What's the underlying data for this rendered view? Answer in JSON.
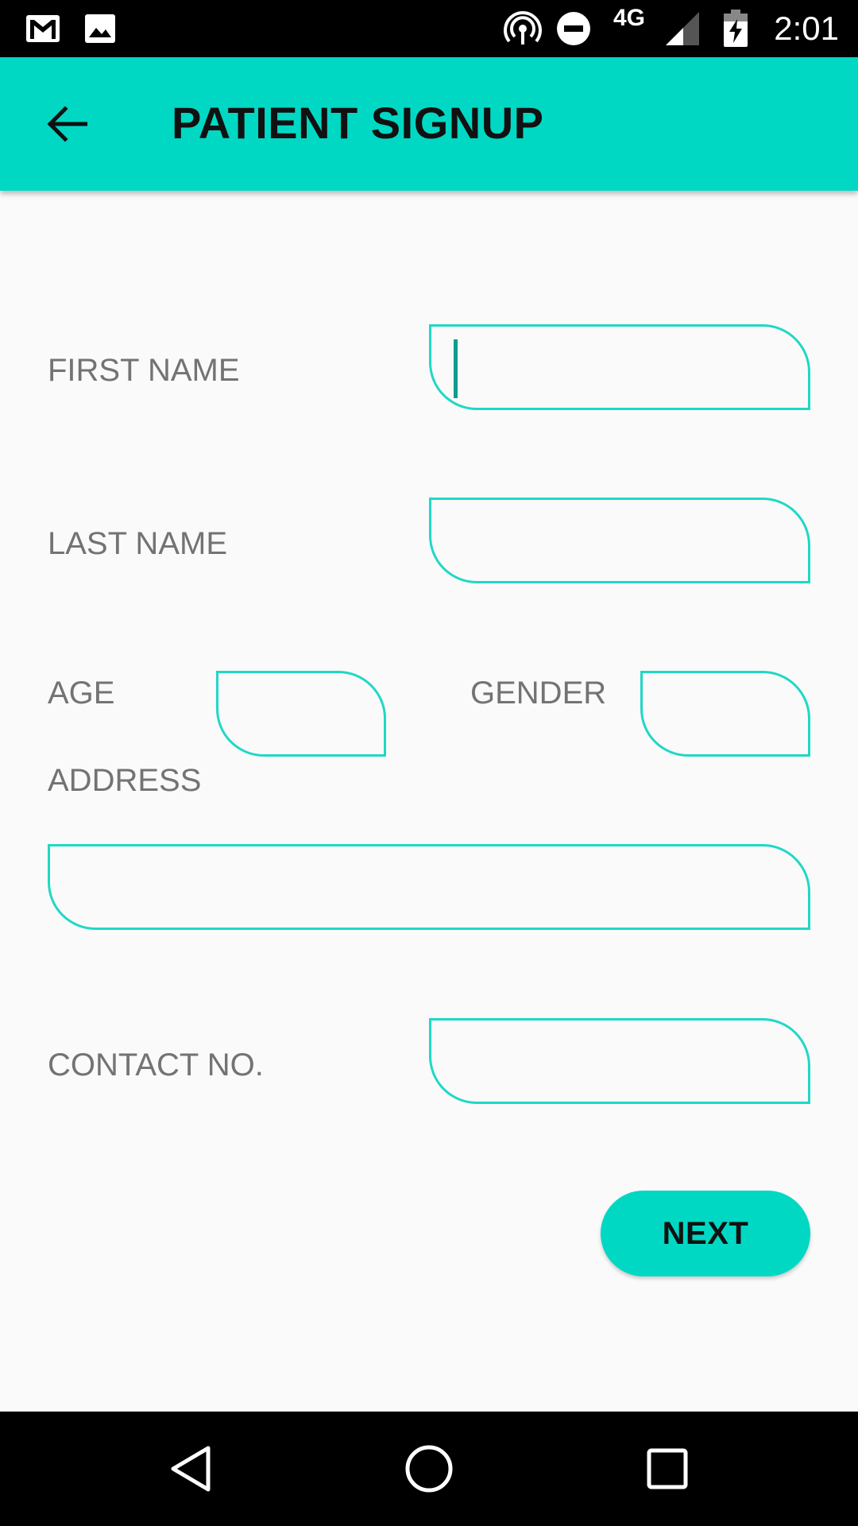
{
  "status_bar": {
    "time": "2:01",
    "network": "4G",
    "icons": [
      "gmail-icon",
      "image-icon",
      "hotspot-icon",
      "do-not-disturb-icon",
      "signal-icon",
      "battery-charging-icon"
    ]
  },
  "app_bar": {
    "title": "PATIENT SIGNUP",
    "back_icon": "arrow-back-icon"
  },
  "form": {
    "first_name": {
      "label": "FIRST NAME",
      "value": ""
    },
    "last_name": {
      "label": "LAST NAME",
      "value": ""
    },
    "age": {
      "label": "AGE",
      "value": ""
    },
    "gender": {
      "label": "GENDER",
      "value": ""
    },
    "address": {
      "label": "ADDRESS",
      "value": ""
    },
    "contact": {
      "label": "CONTACT NO.",
      "value": ""
    },
    "next_label": "NEXT"
  },
  "colors": {
    "accent": "#00d8c4",
    "field_border": "#1fd8c6",
    "label": "#737373",
    "background": "#fafafa"
  },
  "nav_bar": {
    "icons": [
      "back-triangle-icon",
      "home-circle-icon",
      "recents-square-icon"
    ]
  }
}
